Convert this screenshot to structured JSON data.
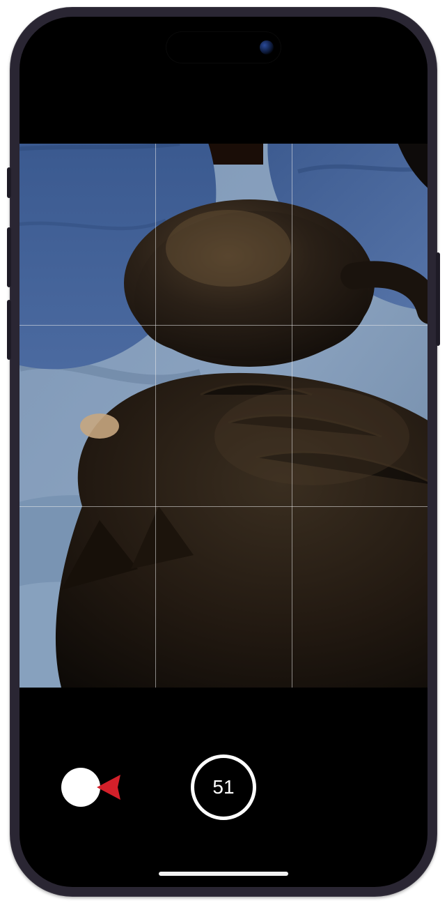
{
  "camera": {
    "burst_count": "51"
  },
  "annotation": {
    "arrow_color": "#d3202a",
    "direction": "left"
  },
  "scene": {
    "description": "Two black cats lying on blue cushions and a blue blanket"
  }
}
